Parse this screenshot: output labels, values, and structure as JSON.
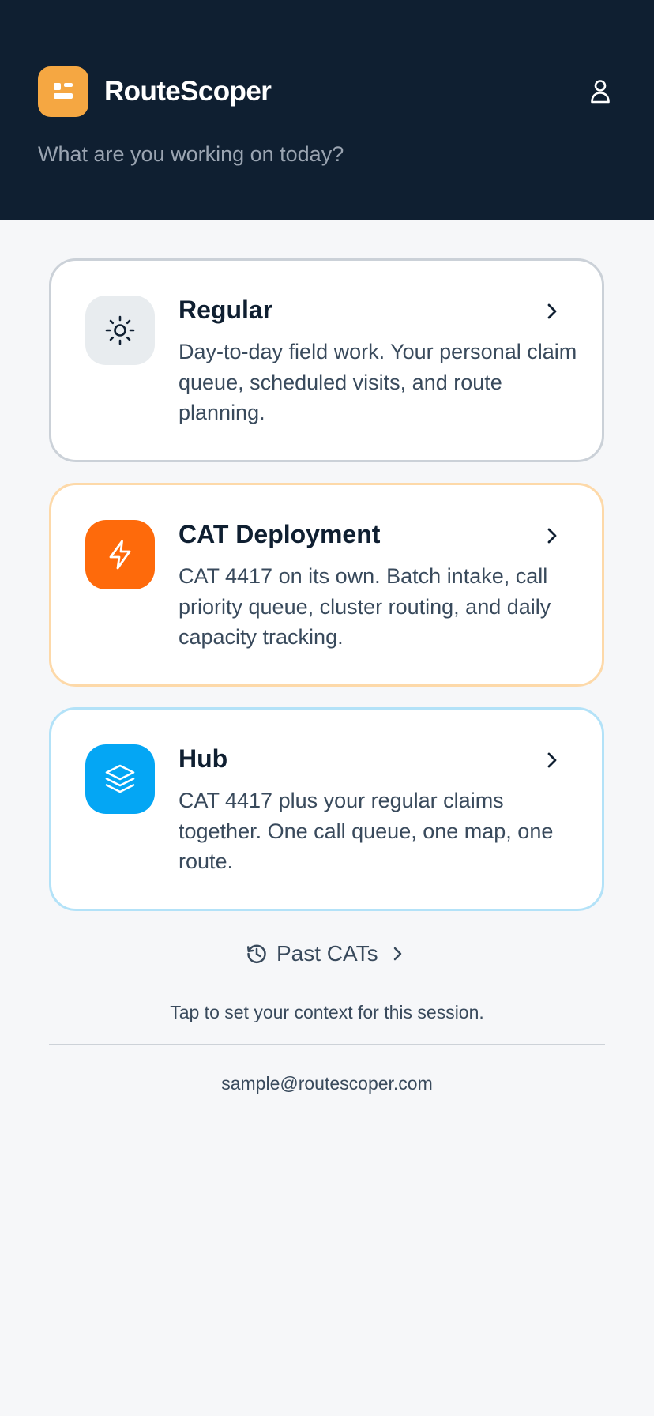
{
  "header": {
    "app_title": "RouteScoper",
    "subtitle": "What are you working on today?",
    "logo_icon": "app-logo-icon",
    "user_icon": "user-icon",
    "background_color": "#0f1f31",
    "logo_color": "#f5a742"
  },
  "modes": [
    {
      "title": "Regular",
      "description": "Day-to-day field work. Your personal claim queue, scheduled visits, and route planning.",
      "icon": "sun-icon",
      "icon_bg": "#e8ecef",
      "border_color": "#cbd1d8"
    },
    {
      "title": "CAT Deployment",
      "description": "CAT 4417 on its own. Batch intake, call priority queue, cluster routing, and daily capacity tracking.",
      "icon": "lightning-icon",
      "icon_bg": "#fe6a0b",
      "border_color": "#fdd9a9"
    },
    {
      "title": "Hub",
      "description": "CAT 4417 plus your regular claims together. One call queue, one map, one route.",
      "icon": "layers-icon",
      "icon_bg": "#04a6f4",
      "border_color": "#b3e2f8"
    }
  ],
  "past_cats": {
    "label": "Past CATs",
    "icon": "history-icon"
  },
  "footer": {
    "hint": "Tap to set your context for this session.",
    "email": "sample@routescoper.com"
  }
}
